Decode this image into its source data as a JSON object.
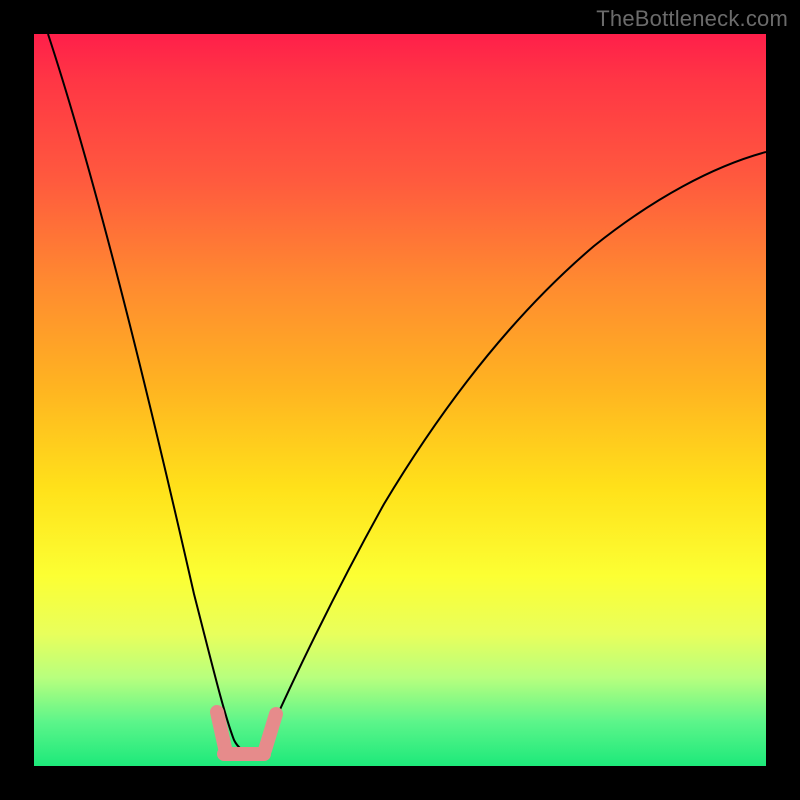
{
  "watermark": "TheBottleneck.com",
  "chart_data": {
    "type": "line",
    "title": "",
    "xlabel": "",
    "ylabel": "",
    "xlim": [
      0,
      100
    ],
    "ylim": [
      0,
      100
    ],
    "grid": false,
    "series": [
      {
        "name": "bottleneck-curve",
        "x": [
          2,
          4,
          6,
          8,
          10,
          12,
          14,
          16,
          18,
          20,
          22,
          24,
          25,
          26,
          27,
          28,
          29,
          30,
          31,
          32,
          34,
          37,
          40,
          44,
          48,
          52,
          56,
          60,
          65,
          70,
          75,
          80,
          85,
          90,
          95,
          100
        ],
        "y": [
          100,
          91,
          82,
          73,
          64,
          55,
          47,
          39,
          31,
          24,
          17,
          10,
          7,
          4,
          2,
          1,
          0.5,
          1,
          2,
          4,
          8,
          14,
          20,
          27,
          34,
          40,
          46,
          51,
          57,
          62,
          67,
          71,
          75,
          78,
          81,
          84
        ]
      },
      {
        "name": "ideal-bottom-markers",
        "x": [
          25,
          26,
          27,
          28,
          29,
          30,
          31
        ],
        "y": [
          6,
          3,
          1.5,
          1,
          1,
          2,
          4
        ]
      }
    ],
    "minimum_at_x": 28,
    "annotations": []
  }
}
